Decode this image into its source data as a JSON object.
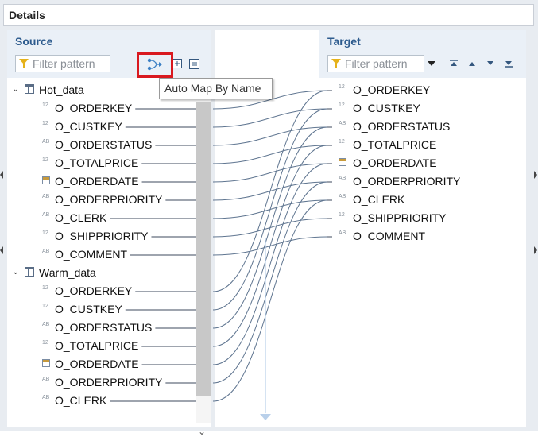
{
  "window": {
    "title": "Details"
  },
  "source": {
    "title": "Source",
    "filter_placeholder": "Filter pattern",
    "tooltip": "Auto Map By Name",
    "tables": [
      {
        "name": "Hot_data",
        "fields": [
          {
            "name": "O_ORDERKEY",
            "type": "12"
          },
          {
            "name": "O_CUSTKEY",
            "type": "12"
          },
          {
            "name": "O_ORDERSTATUS",
            "type": "AB"
          },
          {
            "name": "O_TOTALPRICE",
            "type": "12"
          },
          {
            "name": "O_ORDERDATE",
            "type": "date"
          },
          {
            "name": "O_ORDERPRIORITY",
            "type": "AB"
          },
          {
            "name": "O_CLERK",
            "type": "AB"
          },
          {
            "name": "O_SHIPPRIORITY",
            "type": "12"
          },
          {
            "name": "O_COMMENT",
            "type": "AB"
          }
        ]
      },
      {
        "name": "Warm_data",
        "fields": [
          {
            "name": "O_ORDERKEY",
            "type": "12"
          },
          {
            "name": "O_CUSTKEY",
            "type": "12"
          },
          {
            "name": "O_ORDERSTATUS",
            "type": "AB"
          },
          {
            "name": "O_TOTALPRICE",
            "type": "12"
          },
          {
            "name": "O_ORDERDATE",
            "type": "date"
          },
          {
            "name": "O_ORDERPRIORITY",
            "type": "AB"
          },
          {
            "name": "O_CLERK",
            "type": "AB"
          }
        ]
      }
    ]
  },
  "target": {
    "title": "Target",
    "filter_placeholder": "Filter pattern",
    "fields": [
      {
        "name": "O_ORDERKEY",
        "type": "12"
      },
      {
        "name": "O_CUSTKEY",
        "type": "12"
      },
      {
        "name": "O_ORDERSTATUS",
        "type": "AB"
      },
      {
        "name": "O_TOTALPRICE",
        "type": "12"
      },
      {
        "name": "O_ORDERDATE",
        "type": "date"
      },
      {
        "name": "O_ORDERPRIORITY",
        "type": "AB"
      },
      {
        "name": "O_CLERK",
        "type": "AB"
      },
      {
        "name": "O_SHIPPRIORITY",
        "type": "12"
      },
      {
        "name": "O_COMMENT",
        "type": "AB"
      }
    ]
  },
  "icons": {
    "auto_map": "auto-map-icon",
    "expand_all": "expand-all-icon",
    "collapse_all": "collapse-all-icon",
    "filter": "filter-icon",
    "dropdown": "dropdown-icon",
    "move_top": "move-top-icon",
    "move_up": "move-up-icon",
    "move_down": "move-down-icon",
    "move_bottom": "move-bottom-icon"
  },
  "colors": {
    "header_bg": "#eaf0f7",
    "title_blue": "#2d5b8e",
    "highlight_red": "#d9191f",
    "link_line": "#3d4a5c"
  }
}
